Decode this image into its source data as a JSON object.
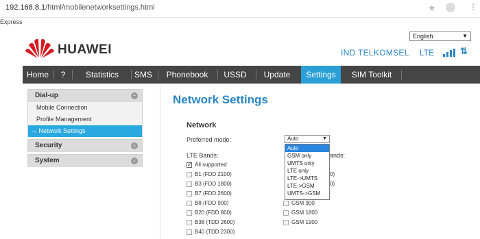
{
  "browser": {
    "url_host": "192.168.8.1",
    "url_path": "/html/mobilenetworksettings.html",
    "bookmark": "Express"
  },
  "header": {
    "language": "English",
    "brand": "HUAWEI",
    "operator": "IND TELKOMSEL",
    "network_type": "LTE",
    "signal_bars": 4,
    "data_icon": "data-transfer-icon"
  },
  "nav": {
    "items": [
      {
        "label": "Home"
      },
      {
        "label": "?"
      },
      {
        "label": "Statistics"
      },
      {
        "label": "SMS"
      },
      {
        "label": "Phonebook"
      },
      {
        "label": "USSD"
      },
      {
        "label": "Update"
      },
      {
        "label": "Settings"
      },
      {
        "label": "SIM Toolkit"
      }
    ],
    "active_index": 7
  },
  "sidebar": {
    "groups": [
      {
        "label": "Dial-up",
        "sub": [
          "Mobile Connection",
          "Profile Management",
          "→ Network Settings"
        ]
      },
      {
        "label": "Security"
      },
      {
        "label": "System"
      }
    ]
  },
  "main": {
    "title": "Network Settings",
    "section": "Network",
    "preferred_mode_label": "Preferred mode:",
    "preferred_mode_value": "Auto",
    "dropdown_options": [
      "Auto",
      "GSM only",
      "UMTS only",
      "LTE only",
      "LTE->UMTS",
      "LTE->GSM",
      "UMTS->GSM"
    ],
    "lte_bands_label": "LTE Bands:",
    "gsm_bands_label_tail": "ands:",
    "lte_bands": [
      {
        "label": "All supported",
        "checked": true
      },
      {
        "label": "B1 (FDD 2100)",
        "checked": false
      },
      {
        "label": "B3 (FDD 1800)",
        "checked": false
      },
      {
        "label": "B7 (FDD 2600)",
        "checked": false
      },
      {
        "label": "B8 (FDD 900)",
        "checked": false
      },
      {
        "label": "B20 (FDD 800)",
        "checked": false
      },
      {
        "label": "B38 (TDD 2600)",
        "checked": false
      },
      {
        "label": "B40 (TDD 2300)",
        "checked": false
      }
    ],
    "gsm_bands": [
      {
        "label": "GSM 900",
        "checked": false
      },
      {
        "label": "GSM 1800",
        "checked": false
      },
      {
        "label": "GSM 1900",
        "checked": false
      }
    ],
    "partial_fragments": [
      "0)",
      "0)"
    ]
  }
}
